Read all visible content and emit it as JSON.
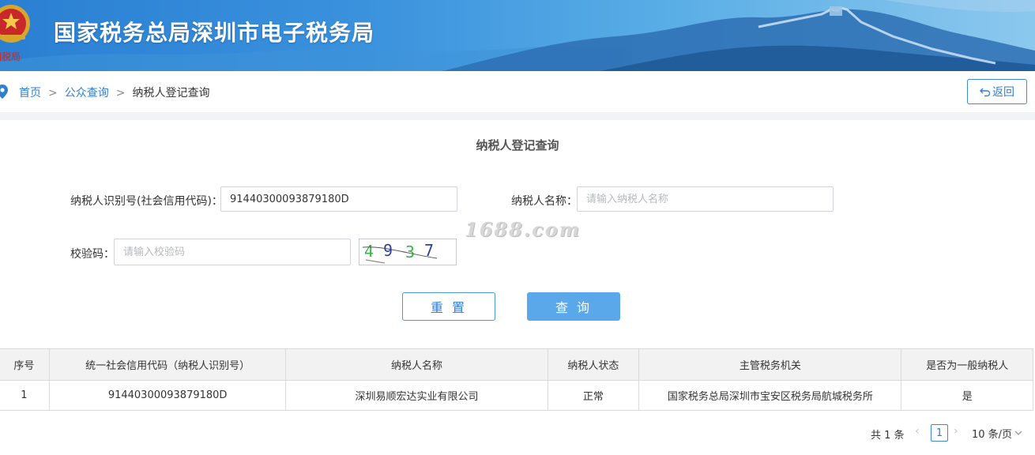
{
  "header": {
    "title": "国家税务总局深圳市电子税务局",
    "emblem_text": "国税局"
  },
  "breadcrumb": {
    "home": "首页",
    "separator": ">",
    "public_query": "公众查询",
    "current": "纳税人登记查询"
  },
  "back_button": {
    "label": "返回"
  },
  "form": {
    "title": "纳税人登记查询",
    "tax_id_label": "纳税人识别号(社会信用代码)：",
    "tax_id_value": "91440300093879180D",
    "name_label": "纳税人名称：",
    "name_placeholder": "请输入纳税人名称",
    "captcha_label": "校验码：",
    "captcha_placeholder": "请输入校验码",
    "captcha_chars": [
      "4",
      "9",
      "3",
      "7"
    ],
    "reset_label": "重 置",
    "query_label": "查 询"
  },
  "watermark": "1688.com",
  "table": {
    "columns": [
      "序号",
      "统一社会信用代码（纳税人识别号）",
      "纳税人名称",
      "纳税人状态",
      "主管税务机关",
      "是否为一般纳税人"
    ],
    "rows": [
      [
        "1",
        "91440300093879180D",
        "深圳易顺宏达实业有限公司",
        "正常",
        "国家税务总局深圳市宝安区税务局航城税务所",
        "是"
      ]
    ]
  },
  "pagination": {
    "total": "共 1 条",
    "current_page": "1",
    "page_size": "10 条/页"
  },
  "colors": {
    "accent": "#2f7fd0",
    "query_button": "#5aa8ea",
    "banner_start": "#2a7fd2",
    "banner_end": "#8cc8ee"
  }
}
